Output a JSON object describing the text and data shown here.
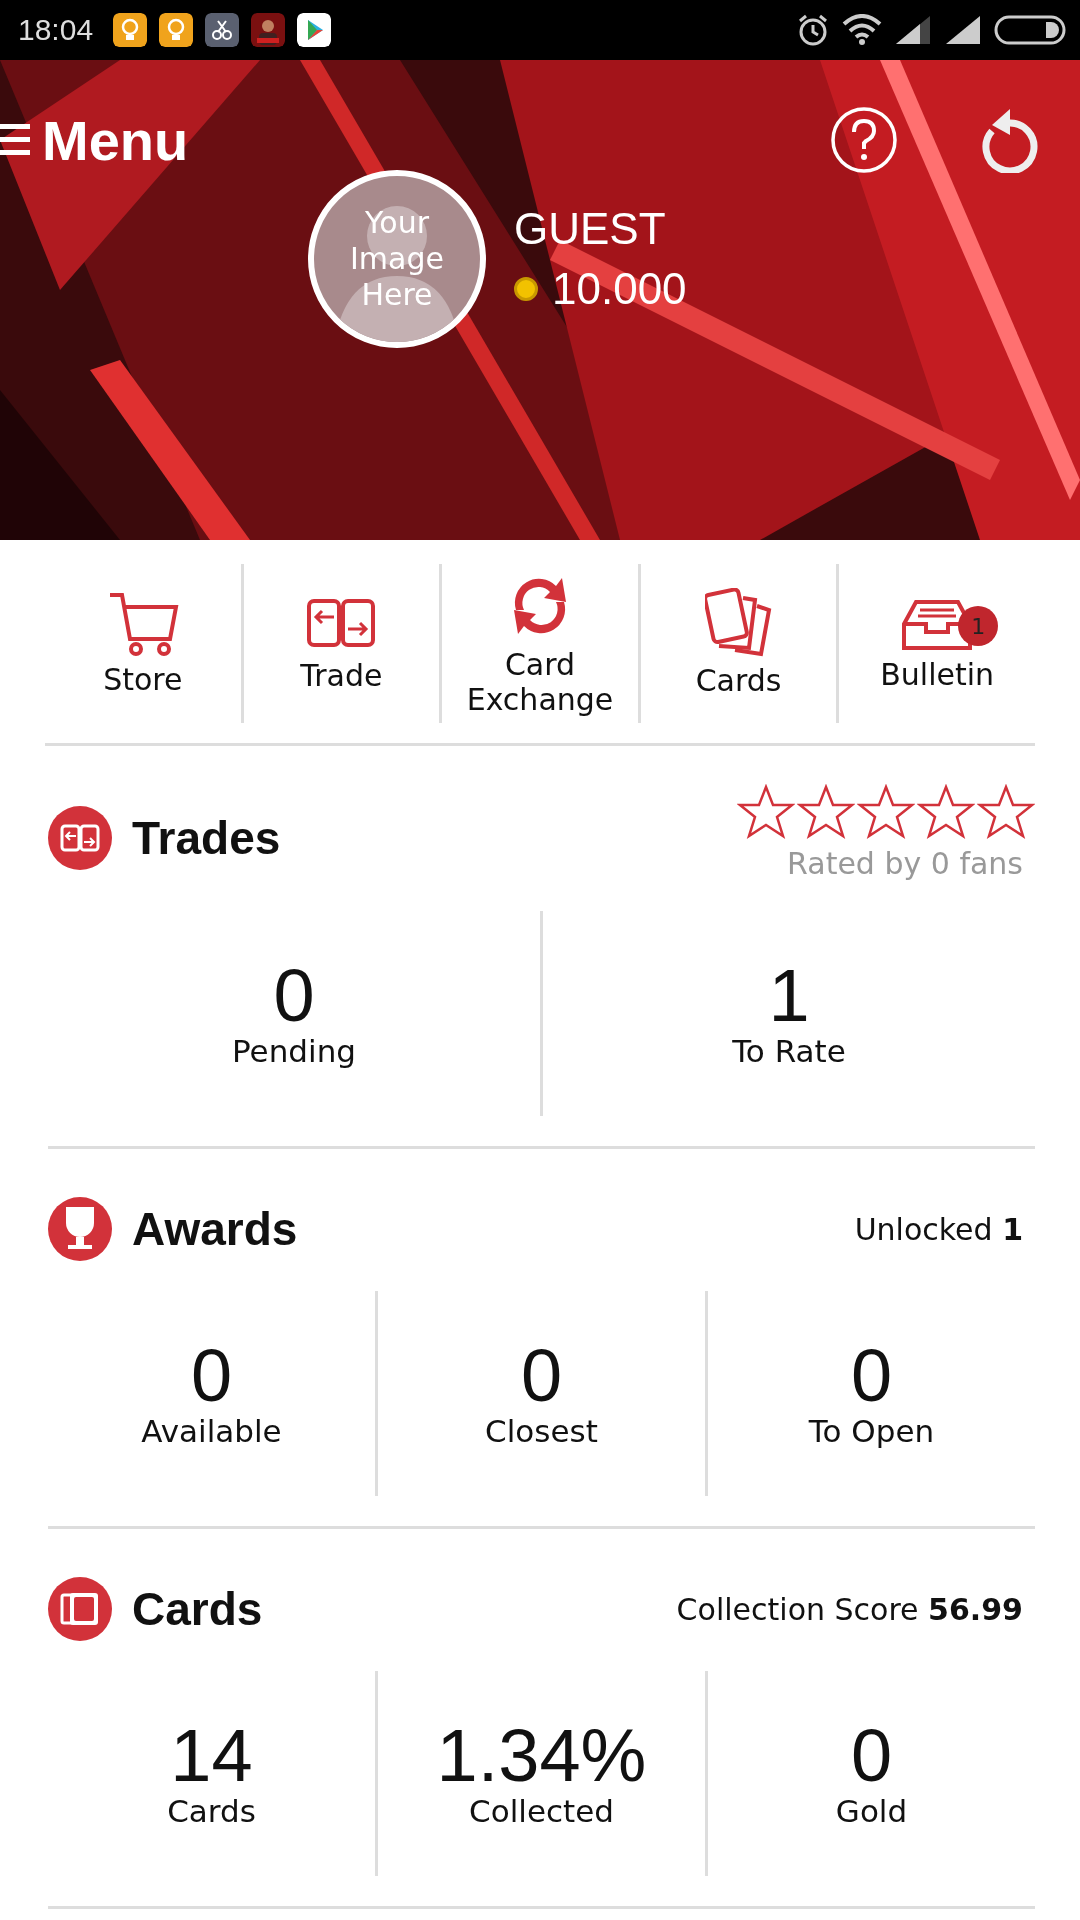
{
  "status_bar": {
    "time": "18:04",
    "notifications": [
      {
        "kind": "bulb"
      },
      {
        "kind": "bulb"
      },
      {
        "kind": "scissors"
      },
      {
        "kind": "app"
      },
      {
        "kind": "play"
      }
    ]
  },
  "header": {
    "title": "Menu",
    "avatar_text": "Your Image Here",
    "username": "GUEST",
    "coins": "10.000"
  },
  "nav": [
    {
      "label": "Store",
      "kind": "cart"
    },
    {
      "label": "Trade",
      "kind": "trade"
    },
    {
      "label": "Card Exchange",
      "kind": "exchange"
    },
    {
      "label": "Cards",
      "kind": "cards"
    },
    {
      "label": "Bulletin",
      "kind": "inbox",
      "badge": "1"
    }
  ],
  "sections": [
    {
      "title": "Trades",
      "kind": "trade",
      "stars": 0,
      "rating": "Rated by 0 fans",
      "stats": [
        {
          "value": "0",
          "label": "Pending"
        },
        {
          "value": "1",
          "label": "To Rate"
        }
      ]
    },
    {
      "title": "Awards",
      "kind": "trophy",
      "info": "Unlocked **1**",
      "stats": [
        {
          "value": "0",
          "label": "Available"
        },
        {
          "value": "0",
          "label": "Closest"
        },
        {
          "value": "0",
          "label": "To Open"
        }
      ]
    },
    {
      "title": "Cards",
      "kind": "cards",
      "info": "Collection Score **56.99**",
      "stats": [
        {
          "value": "14",
          "label": "Cards"
        },
        {
          "value": "1.34%",
          "label": "Collected"
        },
        {
          "value": "0",
          "label": "Gold"
        }
      ]
    }
  ]
}
